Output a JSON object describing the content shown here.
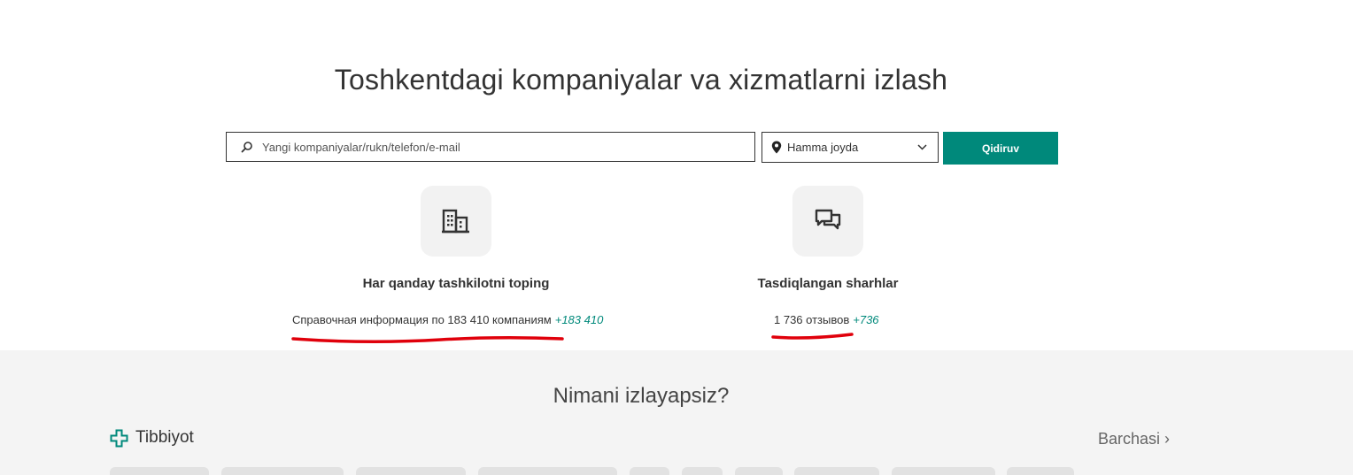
{
  "hero": {
    "title": "Toshkentdagi kompaniyalar va xizmatlarni izlash"
  },
  "search": {
    "placeholder": "Yangi kompaniyalar/rukn/telefon/e-mail",
    "value": "",
    "icon": "search-icon"
  },
  "location": {
    "selected": "Hamma joyda",
    "icon": "map-pin-icon"
  },
  "search_button": {
    "label": "Qidiruv",
    "color": "#00897b"
  },
  "features": [
    {
      "icon": "buildings-icon",
      "title": "Har qanday tashkilotni toping",
      "stat": "Справочная информация по 183 410 компаниям",
      "delta": "+183 410"
    },
    {
      "icon": "chat-bubbles-icon",
      "title": "Tasdiqlangan sharhlar",
      "stat": "1 736 отзывов",
      "delta": "+736"
    }
  ],
  "annotation_color": "#e0000b",
  "catalog": {
    "title": "Nimani izlayapsiz?",
    "category": {
      "icon": "medical-cross-icon",
      "label": "Tibbiyot"
    },
    "all_link": "Barchasi ›"
  }
}
